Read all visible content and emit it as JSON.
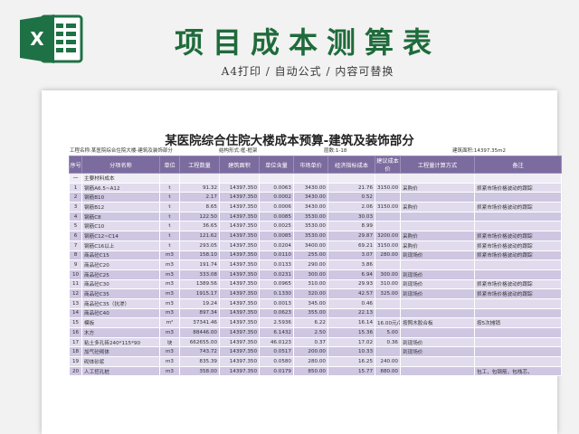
{
  "header": {
    "logo_letter": "X",
    "title": "项目成本测算表",
    "subtitle": "A4打印 / 自动公式 / 内容可替换"
  },
  "document": {
    "title": "某医院综合住院大楼成本预算-建筑及装饰部分",
    "info": {
      "project": "工程名称:某医院综合住院大楼-建筑及装饰部分",
      "structure": "结构形式:框-框架",
      "floors": "层数:1-18",
      "area": "建筑面积:14397.35m2"
    }
  },
  "table": {
    "columns": [
      "序号",
      "分项名称",
      "单位",
      "工程数量",
      "建筑面积",
      "单位含量",
      "市场单价",
      "经济指标成本",
      "建议成本价",
      "工程量计算方式",
      "备注"
    ],
    "section": {
      "no": "一",
      "name": "主要材料成本"
    },
    "rows": [
      {
        "no": "1",
        "name": "钢筋A6.5~A12",
        "unit": "t",
        "qty": "91.32",
        "area": "14397.350",
        "content": "0.0063",
        "price": "3430.00",
        "index": "21.76",
        "suggest": "3150.00",
        "method": "采购价",
        "note": "抓紧市场价格波动的跟踪"
      },
      {
        "no": "2",
        "name": "钢筋B10",
        "unit": "t",
        "qty": "2.17",
        "area": "14397.350",
        "content": "0.0002",
        "price": "3430.00",
        "index": "0.52",
        "suggest": "",
        "method": "",
        "note": ""
      },
      {
        "no": "3",
        "name": "钢筋B12",
        "unit": "t",
        "qty": "8.65",
        "area": "14397.350",
        "content": "0.0006",
        "price": "3430.00",
        "index": "2.06",
        "suggest": "3150.00",
        "method": "采购价",
        "note": "抓紧市场价格波动的跟踪"
      },
      {
        "no": "4",
        "name": "钢筋C8",
        "unit": "t",
        "qty": "122.50",
        "area": "14397.350",
        "content": "0.0085",
        "price": "3530.00",
        "index": "30.03",
        "suggest": "",
        "method": "",
        "note": ""
      },
      {
        "no": "5",
        "name": "钢筋C10",
        "unit": "t",
        "qty": "36.65",
        "area": "14397.350",
        "content": "0.0025",
        "price": "3530.00",
        "index": "8.99",
        "suggest": "",
        "method": "",
        "note": ""
      },
      {
        "no": "6",
        "name": "钢筋C12~C14",
        "unit": "t",
        "qty": "121.62",
        "area": "14397.350",
        "content": "0.0085",
        "price": "3530.00",
        "index": "29.87",
        "suggest": "3200.00",
        "method": "采购价",
        "note": "抓紧市场价格波动的跟踪"
      },
      {
        "no": "7",
        "name": "钢筋C16以上",
        "unit": "t",
        "qty": "293.05",
        "area": "14397.350",
        "content": "0.0204",
        "price": "3400.00",
        "index": "69.21",
        "suggest": "3150.00",
        "method": "采购价",
        "note": "抓紧市场价格波动的跟踪"
      },
      {
        "no": "8",
        "name": "商品砼C15",
        "unit": "m3",
        "qty": "158.10",
        "area": "14397.350",
        "content": "0.0110",
        "price": "255.00",
        "index": "3.07",
        "suggest": "280.00",
        "method": "到现场价",
        "note": "抓紧市场价格波动的跟踪"
      },
      {
        "no": "9",
        "name": "商品砼C20",
        "unit": "m3",
        "qty": "191.74",
        "area": "14397.350",
        "content": "0.0133",
        "price": "290.00",
        "index": "3.86",
        "suggest": "",
        "method": "",
        "note": ""
      },
      {
        "no": "10",
        "name": "商品砼C25",
        "unit": "m3",
        "qty": "333.08",
        "area": "14397.350",
        "content": "0.0231",
        "price": "300.00",
        "index": "6.94",
        "suggest": "300.00",
        "method": "到现场价",
        "note": ""
      },
      {
        "no": "11",
        "name": "商品砼C30",
        "unit": "m3",
        "qty": "1389.56",
        "area": "14397.350",
        "content": "0.0965",
        "price": "310.00",
        "index": "29.93",
        "suggest": "310.00",
        "method": "到现场价",
        "note": "抓紧市场价格波动的跟踪"
      },
      {
        "no": "12",
        "name": "商品砼C35",
        "unit": "m3",
        "qty": "1915.17",
        "area": "14397.350",
        "content": "0.1330",
        "price": "320.00",
        "index": "42.57",
        "suggest": "325.00",
        "method": "到现场价",
        "note": "抓紧市场价格波动的跟踪"
      },
      {
        "no": "13",
        "name": "商品砼C35（抗渗）",
        "unit": "m3",
        "qty": "19.24",
        "area": "14397.350",
        "content": "0.0013",
        "price": "345.00",
        "index": "0.46",
        "suggest": "",
        "method": "",
        "note": ""
      },
      {
        "no": "14",
        "name": "商品砼C40",
        "unit": "m3",
        "qty": "897.34",
        "area": "14397.350",
        "content": "0.0623",
        "price": "355.00",
        "index": "22.13",
        "suggest": "",
        "method": "",
        "note": ""
      },
      {
        "no": "15",
        "name": "模板",
        "unit": "m²",
        "qty": "37341.46",
        "area": "14397.350",
        "content": "2.5936",
        "price": "6.22",
        "index": "16.14",
        "suggest": "16.00元/吊",
        "method": "按照木胶合板",
        "note": "按5次摊销"
      },
      {
        "no": "16",
        "name": "木方",
        "unit": "m3",
        "qty": "88446.00",
        "area": "14397.350",
        "content": "6.1432",
        "price": "2.50",
        "index": "15.36",
        "suggest": "5.00",
        "method": "",
        "note": ""
      },
      {
        "no": "17",
        "name": "粘土多孔砖240*115*90",
        "unit": "块",
        "qty": "662655.00",
        "area": "14397.350",
        "content": "46.0123",
        "price": "0.37",
        "index": "17.02",
        "suggest": "0.36",
        "method": "到现场价",
        "note": ""
      },
      {
        "no": "18",
        "name": "加气砼砌体",
        "unit": "m3",
        "qty": "743.72",
        "area": "14397.350",
        "content": "0.0517",
        "price": "200.00",
        "index": "10.33",
        "suggest": "",
        "method": "到现场价",
        "note": ""
      },
      {
        "no": "19",
        "name": "砌体砂浆",
        "unit": "m3",
        "qty": "835.39",
        "area": "14397.350",
        "content": "0.0580",
        "price": "280.00",
        "index": "16.25",
        "suggest": "240.00",
        "method": "",
        "note": ""
      },
      {
        "no": "20",
        "name": "人工挖孔桩",
        "unit": "m3",
        "qty": "358.00",
        "area": "14397.350",
        "content": "0.0179",
        "price": "850.00",
        "index": "15.77",
        "suggest": "880.00",
        "method": "",
        "note": "包工，包钢筋，包栈芯，"
      }
    ]
  },
  "colors": {
    "accent": "#1f6b3b",
    "header_bg": "#7b6b9e",
    "row_a": "#e1dbed",
    "row_b": "#cfc6e2"
  }
}
